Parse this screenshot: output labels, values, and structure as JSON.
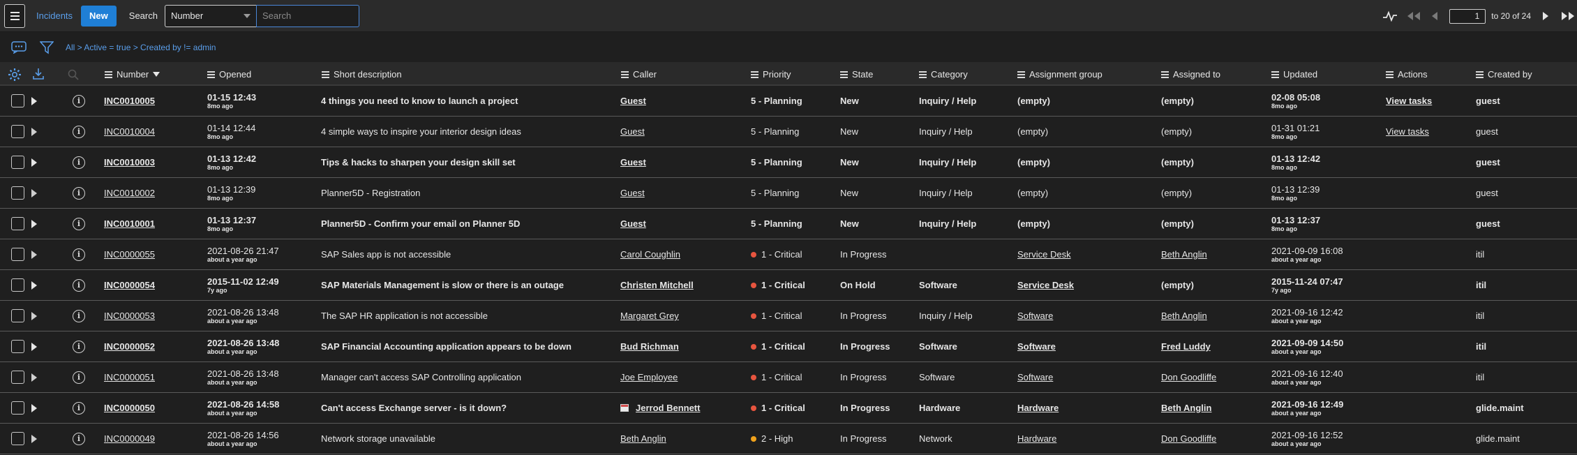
{
  "toolbar": {
    "title": "Incidents",
    "new_label": "New",
    "search_label": "Search",
    "search_field": "Number",
    "search_placeholder": "Search",
    "page_value": "1",
    "page_of": "to 20 of 24"
  },
  "filter": {
    "breadcrumb": "All > Active = true > Created by != admin"
  },
  "columns": {
    "number": "Number",
    "opened": "Opened",
    "short_description": "Short description",
    "caller": "Caller",
    "priority": "Priority",
    "state": "State",
    "category": "Category",
    "assignment_group": "Assignment group",
    "assigned_to": "Assigned to",
    "updated": "Updated",
    "actions": "Actions",
    "created_by": "Created by"
  },
  "colors": {
    "critical": "#e8553f",
    "high": "#f0a21c",
    "link_blue": "#5a9eea",
    "new_button": "#1f7fd6"
  },
  "rows": [
    {
      "hl": true,
      "number": "INC0010005",
      "opened": "01-15 12:43",
      "opened_ago": "8mo ago",
      "desc": "4 things you need to know to launch a project",
      "caller": "Guest",
      "caller_icon": false,
      "priority": "5 - Planning",
      "pcolor": "",
      "state": "New",
      "category": "Inquiry / Help",
      "group": "(empty)",
      "group_link": false,
      "assigned": "(empty)",
      "assigned_link": false,
      "updated": "02-08 05:08",
      "updated_ago": "8mo ago",
      "action": "View tasks",
      "created_by": "guest"
    },
    {
      "hl": false,
      "number": "INC0010004",
      "opened": "01-14 12:44",
      "opened_ago": "8mo ago",
      "desc": "4 simple ways to inspire your interior design ideas",
      "caller": "Guest",
      "caller_icon": false,
      "priority": "5 - Planning",
      "pcolor": "",
      "state": "New",
      "category": "Inquiry / Help",
      "group": "(empty)",
      "group_link": false,
      "assigned": "(empty)",
      "assigned_link": false,
      "updated": "01-31 01:21",
      "updated_ago": "8mo ago",
      "action": "View tasks",
      "created_by": "guest"
    },
    {
      "hl": true,
      "number": "INC0010003",
      "opened": "01-13 12:42",
      "opened_ago": "8mo ago",
      "desc": "Tips & hacks to sharpen your design skill set",
      "caller": "Guest",
      "caller_icon": false,
      "priority": "5 - Planning",
      "pcolor": "",
      "state": "New",
      "category": "Inquiry / Help",
      "group": "(empty)",
      "group_link": false,
      "assigned": "(empty)",
      "assigned_link": false,
      "updated": "01-13 12:42",
      "updated_ago": "8mo ago",
      "action": "",
      "created_by": "guest"
    },
    {
      "hl": false,
      "number": "INC0010002",
      "opened": "01-13 12:39",
      "opened_ago": "8mo ago",
      "desc": "Planner5D - Registration",
      "caller": "Guest",
      "caller_icon": false,
      "priority": "5 - Planning",
      "pcolor": "",
      "state": "New",
      "category": "Inquiry / Help",
      "group": "(empty)",
      "group_link": false,
      "assigned": "(empty)",
      "assigned_link": false,
      "updated": "01-13 12:39",
      "updated_ago": "8mo ago",
      "action": "",
      "created_by": "guest"
    },
    {
      "hl": true,
      "number": "INC0010001",
      "opened": "01-13 12:37",
      "opened_ago": "8mo ago",
      "desc": "Planner5D - Confirm your email on Planner 5D",
      "caller": "Guest",
      "caller_icon": false,
      "priority": "5 - Planning",
      "pcolor": "",
      "state": "New",
      "category": "Inquiry / Help",
      "group": "(empty)",
      "group_link": false,
      "assigned": "(empty)",
      "assigned_link": false,
      "updated": "01-13 12:37",
      "updated_ago": "8mo ago",
      "action": "",
      "created_by": "guest"
    },
    {
      "hl": false,
      "number": "INC0000055",
      "opened": "2021-08-26 21:47",
      "opened_ago": "about a year ago",
      "desc": "SAP Sales app is not accessible",
      "caller": "Carol Coughlin",
      "caller_icon": false,
      "priority": "1 - Critical",
      "pcolor": "critical",
      "state": "In Progress",
      "category": "",
      "group": "Service Desk",
      "group_link": true,
      "assigned": "Beth Anglin",
      "assigned_link": true,
      "updated": "2021-09-09 16:08",
      "updated_ago": "about a year ago",
      "action": "",
      "created_by": "itil"
    },
    {
      "hl": true,
      "number": "INC0000054",
      "opened": "2015-11-02 12:49",
      "opened_ago": "7y ago",
      "desc": "SAP Materials Management is slow or there is an outage",
      "caller": "Christen Mitchell",
      "caller_icon": false,
      "priority": "1 - Critical",
      "pcolor": "critical",
      "state": "On Hold",
      "category": "Software",
      "group": "Service Desk",
      "group_link": true,
      "assigned": "(empty)",
      "assigned_link": false,
      "updated": "2015-11-24 07:47",
      "updated_ago": "7y ago",
      "action": "",
      "created_by": "itil"
    },
    {
      "hl": false,
      "number": "INC0000053",
      "opened": "2021-08-26 13:48",
      "opened_ago": "about a year ago",
      "desc": "The SAP HR application is not accessible",
      "caller": "Margaret Grey",
      "caller_icon": false,
      "priority": "1 - Critical",
      "pcolor": "critical",
      "state": "In Progress",
      "category": "Inquiry / Help",
      "group": "Software",
      "group_link": true,
      "assigned": "Beth Anglin",
      "assigned_link": true,
      "updated": "2021-09-16 12:42",
      "updated_ago": "about a year ago",
      "action": "",
      "created_by": "itil"
    },
    {
      "hl": true,
      "number": "INC0000052",
      "opened": "2021-08-26 13:48",
      "opened_ago": "about a year ago",
      "desc": "SAP Financial Accounting application appears to be down",
      "caller": "Bud Richman",
      "caller_icon": false,
      "priority": "1 - Critical",
      "pcolor": "critical",
      "state": "In Progress",
      "category": "Software",
      "group": "Software",
      "group_link": true,
      "assigned": "Fred Luddy",
      "assigned_link": true,
      "updated": "2021-09-09 14:50",
      "updated_ago": "about a year ago",
      "action": "",
      "created_by": "itil"
    },
    {
      "hl": false,
      "number": "INC0000051",
      "opened": "2021-08-26 13:48",
      "opened_ago": "about a year ago",
      "desc": "Manager can't access SAP Controlling application",
      "caller": "Joe Employee",
      "caller_icon": false,
      "priority": "1 - Critical",
      "pcolor": "critical",
      "state": "In Progress",
      "category": "Software",
      "group": "Software",
      "group_link": true,
      "assigned": "Don Goodliffe",
      "assigned_link": true,
      "updated": "2021-09-16 12:40",
      "updated_ago": "about a year ago",
      "action": "",
      "created_by": "itil"
    },
    {
      "hl": true,
      "number": "INC0000050",
      "opened": "2021-08-26 14:58",
      "opened_ago": "about a year ago",
      "desc": "Can't access Exchange server - is it down?",
      "caller": "Jerrod Bennett",
      "caller_icon": true,
      "priority": "1 - Critical",
      "pcolor": "critical",
      "state": "In Progress",
      "category": "Hardware",
      "group": "Hardware",
      "group_link": true,
      "assigned": "Beth Anglin",
      "assigned_link": true,
      "updated": "2021-09-16 12:49",
      "updated_ago": "about a year ago",
      "action": "",
      "created_by": "glide.maint"
    },
    {
      "hl": false,
      "number": "INC0000049",
      "opened": "2021-08-26 14:56",
      "opened_ago": "about a year ago",
      "desc": "Network storage unavailable",
      "caller": "Beth Anglin",
      "caller_icon": false,
      "priority": "2 - High",
      "pcolor": "high",
      "state": "In Progress",
      "category": "Network",
      "group": "Hardware",
      "group_link": true,
      "assigned": "Don Goodliffe",
      "assigned_link": true,
      "updated": "2021-09-16 12:52",
      "updated_ago": "about a year ago",
      "action": "",
      "created_by": "glide.maint"
    }
  ]
}
